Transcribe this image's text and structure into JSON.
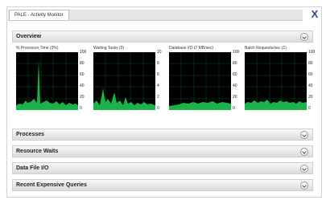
{
  "window": {
    "tab_title": "PALE - Activity Monitor",
    "close_label": "X"
  },
  "sections": {
    "overview": "Overview",
    "processes": "Processes",
    "resource_waits": "Resource Waits",
    "data_file_io": "Data File I/O",
    "recent_expensive_queries": "Recent Expensive Queries"
  },
  "graphs": [
    {
      "label": "% Processor Time (3%)",
      "axis": [
        "100",
        "80",
        "60",
        "40",
        "20",
        "0"
      ]
    },
    {
      "label": "Waiting Tasks (0)",
      "axis": [
        "10",
        "8",
        "6",
        "4",
        "2",
        "0"
      ]
    },
    {
      "label": "Database I/O (7 MB/sec)",
      "axis": [
        "100",
        "80",
        "60",
        "40",
        "20",
        "0"
      ]
    },
    {
      "label": "Batch Requests/sec (1)",
      "axis": [
        "100",
        "80",
        "60",
        "40",
        "20",
        "0"
      ]
    }
  ],
  "colors": {
    "graph_background": "#000000",
    "graph_line": "#1bb24c",
    "grid": "#0b4d22"
  }
}
